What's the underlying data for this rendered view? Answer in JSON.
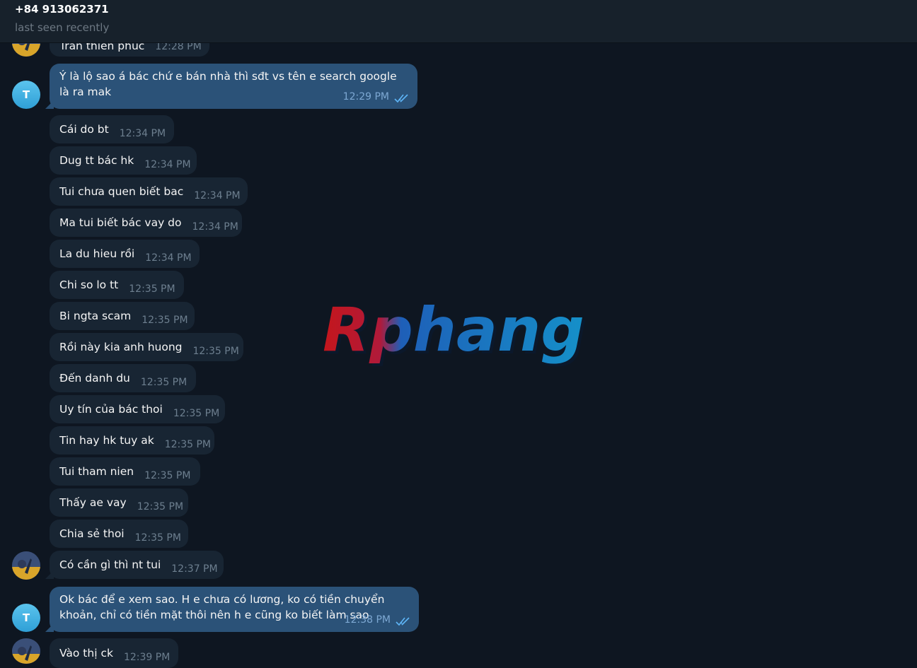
{
  "header": {
    "name": "+84 913062371",
    "status": "last seen recently"
  },
  "avatar_letter": "T",
  "messages": [
    {
      "text": "Trần thiên phúc",
      "time": "12:28 PM"
    },
    {
      "text": "Ý là lộ sao á bác chứ e bán nhà thì sđt vs tên e search google là ra mak",
      "time": "12:29 PM"
    },
    {
      "text": "Cái do bt",
      "time": "12:34 PM"
    },
    {
      "text": "Dug tt bác hk",
      "time": "12:34 PM"
    },
    {
      "text": "Tui chưa quen biết bac",
      "time": "12:34 PM"
    },
    {
      "text": "Ma tui biết bác vay do",
      "time": "12:34 PM"
    },
    {
      "text": "La du hieu rồi",
      "time": "12:34 PM"
    },
    {
      "text": "Chi so lo tt",
      "time": "12:35 PM"
    },
    {
      "text": "Bi ngta scam",
      "time": "12:35 PM"
    },
    {
      "text": "Rồi này kia anh huong",
      "time": "12:35 PM"
    },
    {
      "text": "Đến danh du",
      "time": "12:35 PM"
    },
    {
      "text": "Uy tín của bác thoi",
      "time": "12:35 PM"
    },
    {
      "text": "Tin hay hk tuy ak",
      "time": "12:35 PM"
    },
    {
      "text": "Tui tham nien",
      "time": "12:35 PM"
    },
    {
      "text": "Thấy ae vay",
      "time": "12:35 PM"
    },
    {
      "text": "Chia sẻ thoi",
      "time": "12:35 PM"
    },
    {
      "text": "Có cần gì thì nt tui",
      "time": "12:37 PM"
    },
    {
      "text": "Ok bác để e xem sao. H e chưa có lương, ko có tiền chuyển khoản, chỉ có tiền mặt thôi nên h e cũng ko biết làm sao",
      "time": "12:38 PM"
    },
    {
      "text": "Vào thị ck",
      "time": "12:39 PM"
    }
  ],
  "watermark": "Rphang",
  "colors": {
    "background": "#0e1621",
    "incoming": "#182533",
    "outgoing": "#2b5278",
    "read_ticks": "#5eb5f7"
  }
}
